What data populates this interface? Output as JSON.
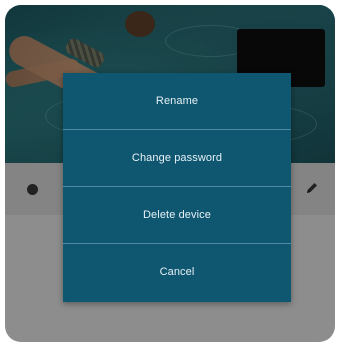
{
  "menu": {
    "items": [
      {
        "label": "Rename"
      },
      {
        "label": "Change password"
      },
      {
        "label": "Delete device"
      },
      {
        "label": "Cancel"
      }
    ]
  },
  "icons": {
    "left_control": "circle-dot-icon",
    "right_control": "pencil-edit-icon"
  },
  "colors": {
    "menu_background": "#0f5670",
    "menu_divider": "#4f8aa0",
    "menu_text": "#e6f1f5"
  }
}
